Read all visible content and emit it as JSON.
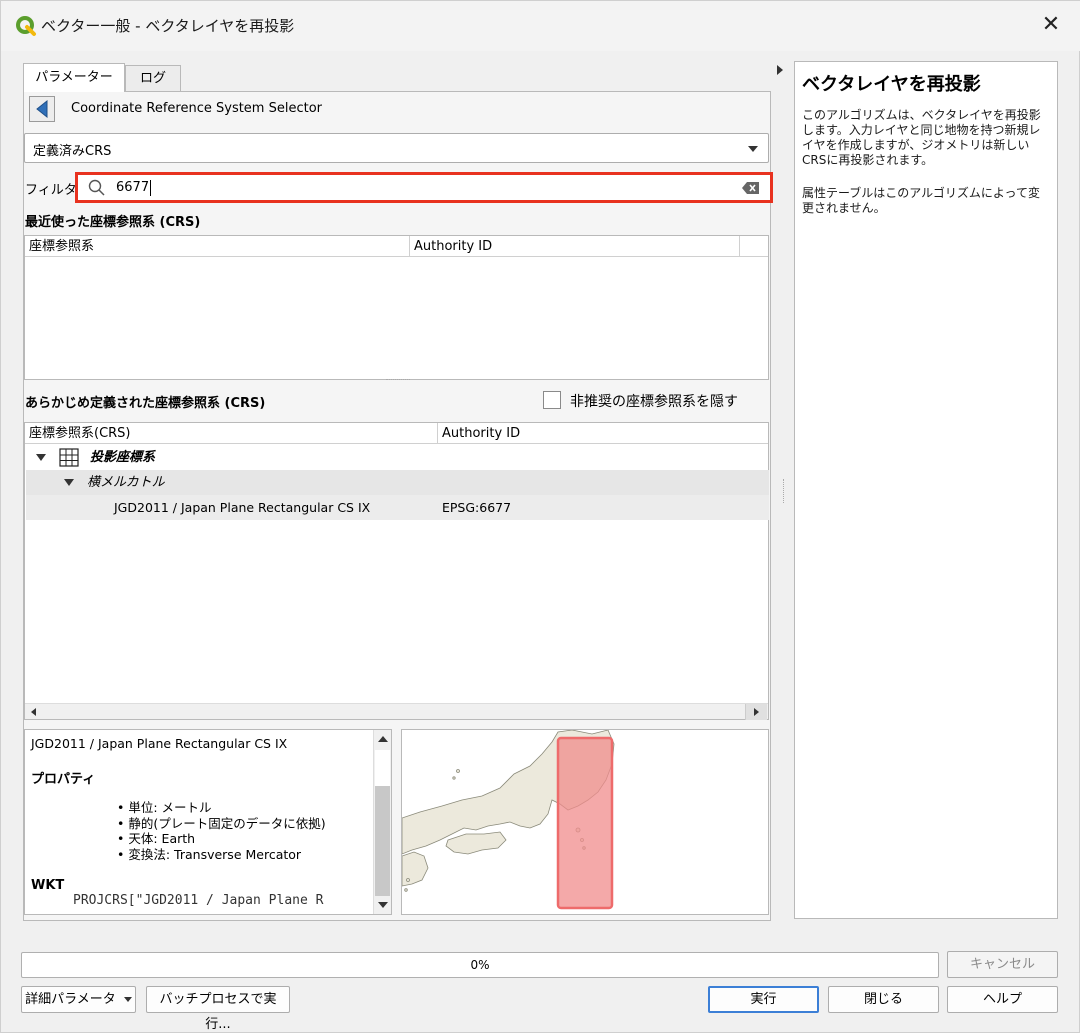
{
  "window": {
    "title": "ベクター一般 - ベクタレイヤを再投影",
    "close_glyph": "✕"
  },
  "tabs": [
    {
      "label": "パラメーター",
      "active": true
    },
    {
      "label": "ログ",
      "active": false
    }
  ],
  "selector": {
    "label": "Coordinate Reference System Selector",
    "dropdown_value": "定義済みCRS"
  },
  "filter": {
    "label": "フィルタ",
    "value": "6677"
  },
  "recent": {
    "title": "最近使った座標参照系 (CRS)",
    "columns": [
      "座標参照系",
      "Authority ID"
    ]
  },
  "predefined": {
    "title": "あらかじめ定義された座標参照系 (CRS)",
    "hide_deprecated_label": "非推奨の座標参照系を隠す",
    "hide_deprecated_checked": false,
    "columns": [
      "座標参照系(CRS)",
      "Authority ID"
    ],
    "tree": {
      "group": "投影座標系",
      "subgroup": "横メルカトル",
      "item_name": "JGD2011 / Japan Plane Rectangular CS IX",
      "item_id": "EPSG:6677"
    }
  },
  "info": {
    "crs_name": "JGD2011 / Japan Plane Rectangular CS IX",
    "properties_title": "プロパティ",
    "properties": [
      "単位: メートル",
      "静的(プレート固定のデータに依拠)",
      "天体: Earth",
      "変換法: Transverse Mercator"
    ],
    "wkt_title": "WKT",
    "wkt_line": "PROJCRS[\"JGD2011 / Japan Plane R"
  },
  "help": {
    "title": "ベクタレイヤを再投影",
    "paragraph1": "このアルゴリズムは、ベクタレイヤを再投影します。入力レイヤと同じ地物を持つ新規レイヤを作成しますが、ジオメトリは新しいCRSに再投影されます。",
    "paragraph2": "属性テーブルはこのアルゴリズムによって変更されません。"
  },
  "progress": {
    "value": 0,
    "label": "0%"
  },
  "buttons": {
    "cancel": "キャンセル",
    "advanced": "詳細パラメータ",
    "batch": "バッチプロセスで実行...",
    "run": "実行",
    "close": "閉じる",
    "help": "ヘルプ"
  },
  "colors": {
    "filter_highlight": "#e8321f",
    "extent_fill": "#f08c8c",
    "land": "#ece9dc"
  }
}
